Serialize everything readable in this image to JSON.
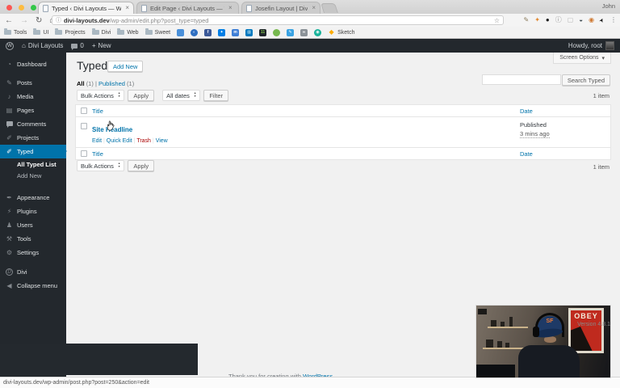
{
  "browser": {
    "profile": "John",
    "tab_close": "×",
    "tabs": [
      {
        "label": "Typed ‹ Divi Layouts — WordPre"
      },
      {
        "label": "Edit Page ‹ Divi Layouts — Wo"
      },
      {
        "label": "Josefin Layout | Divi Layouts"
      }
    ],
    "url_domain": "divi-layouts.dev",
    "url_path": "/wp-admin/edit.php?post_type=typed",
    "bookmark_folders": [
      "Tools",
      "UI",
      "Projects",
      "Divi",
      "Web",
      "Sweet"
    ],
    "bookmark_sketch": "Sketch",
    "favicons": [
      {
        "bg": "#4a90d9",
        "fg": "#ffffff",
        "glyph": ""
      },
      {
        "bg": "#2f6fc1",
        "fg": "#cfe2ff",
        "glyph": "◐"
      },
      {
        "bg": "#3b5998",
        "fg": "#ffffff",
        "glyph": "f"
      },
      {
        "bg": "#007ee5",
        "fg": "#ffffff",
        "glyph": "✦"
      },
      {
        "bg": "#3f7fd6",
        "fg": "#ffffff",
        "glyph": "m"
      },
      {
        "bg": "#0079bf",
        "fg": "#ffffff",
        "glyph": "▥"
      },
      {
        "bg": "#20262b",
        "fg": "#7ec14a",
        "glyph": "11"
      },
      {
        "bg": "#76b84e",
        "fg": "#ffffff",
        "glyph": ""
      },
      {
        "bg": "#3aa3e3",
        "fg": "#ffffff",
        "glyph": "✎"
      },
      {
        "bg": "#8b9298",
        "fg": "#ffffff",
        "glyph": "∞"
      },
      {
        "bg": "#18b29a",
        "fg": "#ffffff",
        "glyph": "◉"
      },
      {
        "bg": "transparent",
        "fg": "#fdad00",
        "glyph": "◆"
      }
    ],
    "extensions": [
      {
        "glyph": "✎",
        "color": "#8a7a5a"
      },
      {
        "glyph": "✦",
        "color": "#e2882e"
      },
      {
        "glyph": "●",
        "color": "#1c1c1c"
      },
      {
        "glyph": "ⓘ",
        "color": "#8a8a8a"
      },
      {
        "glyph": "▢",
        "color": "#b9b9b9"
      },
      {
        "glyph": "◒",
        "color": "#3e4a52"
      },
      {
        "glyph": "◉",
        "color": "#cf7a33"
      },
      {
        "glyph": "➤",
        "color": "#1a1a1a"
      },
      {
        "glyph": "⋮",
        "color": "#5f6368"
      }
    ],
    "status_url": "divi-layouts.dev/wp-admin/post.php?post=250&action=edit"
  },
  "icons": {
    "back": "←",
    "forward": "→",
    "reload": "↻",
    "home": "⌂",
    "info": "ⓘ",
    "star": "☆",
    "chevron_down": "▾",
    "plus": "+",
    "wp": "W",
    "house": "⌂",
    "collapse": "◀",
    "divi": "D"
  },
  "admin_bar": {
    "site": "Divi Layouts",
    "comments": "0",
    "new": "New",
    "howdy": "Howdy, root"
  },
  "sidebar": {
    "items": [
      {
        "label": "Dashboard",
        "glyph": "◔"
      },
      {
        "label": "Posts",
        "glyph": "✎"
      },
      {
        "label": "Media",
        "glyph": "♪"
      },
      {
        "label": "Pages",
        "glyph": "▤"
      },
      {
        "label": "Comments"
      },
      {
        "label": "Projects",
        "glyph": "✐"
      },
      {
        "label": "Typed",
        "glyph": "✐"
      },
      {
        "label": "Appearance",
        "glyph": "✒"
      },
      {
        "label": "Plugins",
        "glyph": "⚡"
      },
      {
        "label": "Users",
        "glyph": "♟"
      },
      {
        "label": "Tools",
        "glyph": "⚒"
      },
      {
        "label": "Settings",
        "glyph": "⚙"
      },
      {
        "label": "Divi"
      },
      {
        "label": "Collapse menu"
      }
    ],
    "submenu": [
      {
        "label": "All Typed List"
      },
      {
        "label": "Add New"
      }
    ]
  },
  "page": {
    "title": "Typed",
    "add_new_button": "Add New",
    "screen_options": "Screen Options",
    "search_button": "Search Typed",
    "sep": "|",
    "views": {
      "all_label": "All",
      "all_count": "(1)",
      "published_label": "Published",
      "published_count": "(1)"
    },
    "bulk_actions_label": "Bulk Actions",
    "apply_button": "Apply",
    "all_dates_label": "All dates",
    "filter_button": "Filter",
    "item_count": "1 item",
    "columns": {
      "title": "Title",
      "date": "Date"
    },
    "rows": [
      {
        "title": "Site Headline",
        "actions": [
          "Edit",
          "Quick Edit",
          "Trash",
          "View"
        ],
        "status": "Published",
        "date": "3 mins ago"
      }
    ],
    "footer_text": "Thank you for creating with ",
    "footer_link": "WordPress",
    "footer_period": ".",
    "version": "Version 4.8.1"
  },
  "webcam": {
    "poster": "OBEY",
    "cap": "SF"
  },
  "colors": {
    "accent": "#0073aa",
    "admin_dark": "#23282d",
    "trash_red": "#aa0000"
  }
}
